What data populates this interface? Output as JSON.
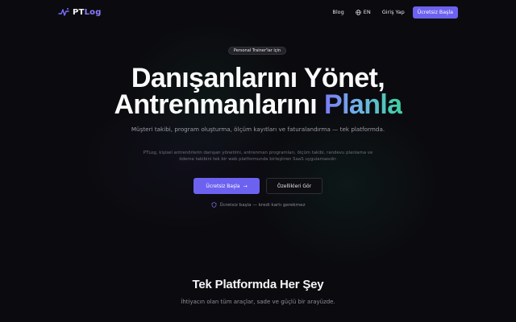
{
  "nav": {
    "logo_pt": "PT",
    "logo_log": "Log",
    "blog": "Blog",
    "lang": "EN",
    "login": "Giriş Yap",
    "cta": "Ücretsiz Başla"
  },
  "hero": {
    "badge": "Personal Trainer'lar için",
    "title_line1": "Danışanlarını Yönet,",
    "title_line2_a": "Antrenmanlarını ",
    "title_line2_b": "Planla",
    "subtitle": "Müşteri takibi, program oluşturma, ölçüm kayıtları ve faturalandırma — tek platformda.",
    "description": "PTLog, kişisel antrenörlerin danışan yönetimi, antrenman programları, ölçüm takibi, randevu planlama ve ödeme takibini tek bir web platformunda birleştiren SaaS uygulamasıdır.",
    "primary_button": "Ücretsiz Başla",
    "primary_arrow": "→",
    "secondary_button": "Özellikleri Gör",
    "note": "Ücretsiz başla — kredi kartı gerekmez"
  },
  "features": {
    "title": "Tek Platformda Her Şey",
    "subtitle": "İhtiyacın olan tüm araçlar, sade ve güçlü bir arayüzde."
  },
  "colors": {
    "accent": "#6d62f0",
    "background": "#0b0b0f",
    "gradient_start": "#7c7cf5",
    "gradient_end": "#3ecf9e"
  },
  "icons": [
    "pulse-logo-icon",
    "globe-icon",
    "arrow-right-icon",
    "shield-icon"
  ]
}
